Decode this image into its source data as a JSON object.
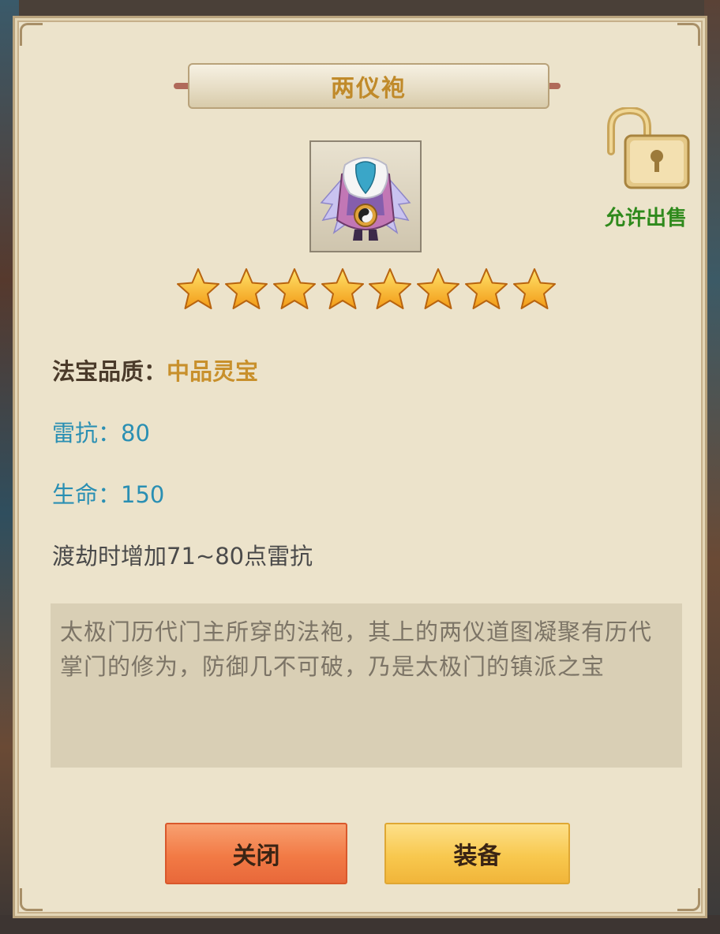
{
  "dialog": {
    "title": "两仪袍",
    "item_icon": "robe-icon",
    "lock": {
      "icon": "unlocked-padlock-icon",
      "label": "允许出售"
    },
    "stars": {
      "count": 8,
      "icon": "star-icon"
    },
    "quality": {
      "label": "法宝品质：",
      "value": "中品灵宝"
    },
    "stats": [
      "雷抗：80",
      "生命：150"
    ],
    "effect": "渡劫时增加71~80点雷抗",
    "description": "太极门历代门主所穿的法袍，其上的两仪道图凝聚有历代掌门的修为，防御几不可破，乃是太极门的镇派之宝",
    "buttons": {
      "close": "关闭",
      "equip": "装备"
    }
  },
  "colors": {
    "title": "#c08a2a",
    "quality_value": "#c8902c",
    "stat": "#2a8fb3",
    "sell_label": "#2f8a1c",
    "close_button": "#f27a45",
    "equip_button": "#f8c84e"
  }
}
